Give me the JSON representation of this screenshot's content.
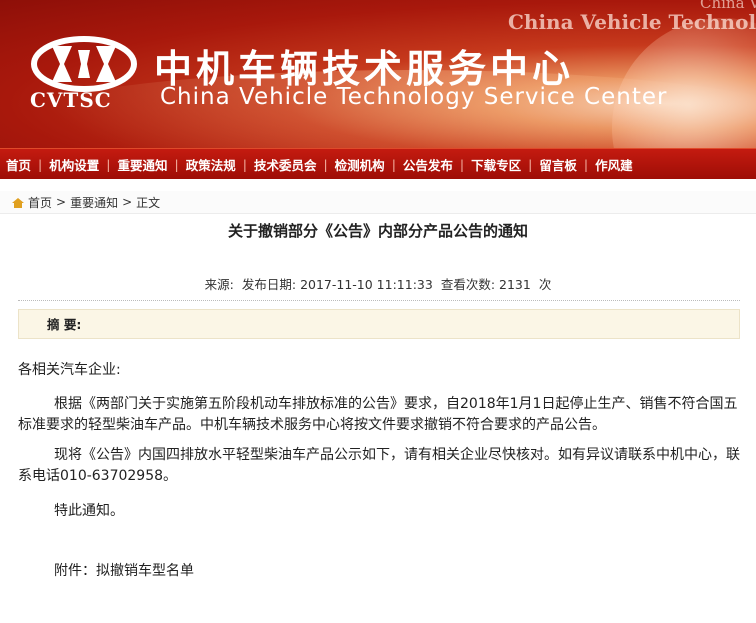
{
  "header": {
    "logo_text": "CVTSC",
    "title_cn": "中机车辆技术服务中心",
    "title_en": "China Vehicle Technology Service Center",
    "watermark_1": "China Vehicle Technolog",
    "watermark_2": "China Vehic",
    "brand_color": "#b5160b"
  },
  "nav": {
    "items": [
      {
        "label": "首页"
      },
      {
        "label": "机构设置"
      },
      {
        "label": "重要通知"
      },
      {
        "label": "政策法规"
      },
      {
        "label": "技术委员会"
      },
      {
        "label": "检测机构"
      },
      {
        "label": "公告发布"
      },
      {
        "label": "下载专区"
      },
      {
        "label": "留言板"
      },
      {
        "label": "作风建"
      }
    ],
    "separator": "|"
  },
  "breadcrumb": {
    "icon": "home-icon",
    "items": [
      "首页",
      "重要通知",
      "正文"
    ],
    "separator": ">"
  },
  "article": {
    "title": "关于撤销部分《公告》内部分产品公告的通知",
    "source_label": "来源:",
    "date_label": "发布日期:",
    "date_value": "2017-11-10 11:11:33",
    "views_label": "查看次数:",
    "views_value": "2131",
    "views_unit": "次",
    "abstract_label": "摘 要:",
    "greeting": "各相关汽车企业:",
    "para1": "根据《两部门关于实施第五阶段机动车排放标准的公告》要求，自2018年1月1日起停止生产、销售不符合国五标准要求的轻型柴油车产品。中机车辆技术服务中心将按文件要求撤销不符合要求的产品公告。",
    "para2": "现将《公告》内国四排放水平轻型柴油车产品公示如下，请有相关企业尽快核对。如有异议请联系中机中心，联系电话010-63702958。",
    "closing": "特此通知。",
    "attachment": "附件：拟撤销车型名单"
  }
}
